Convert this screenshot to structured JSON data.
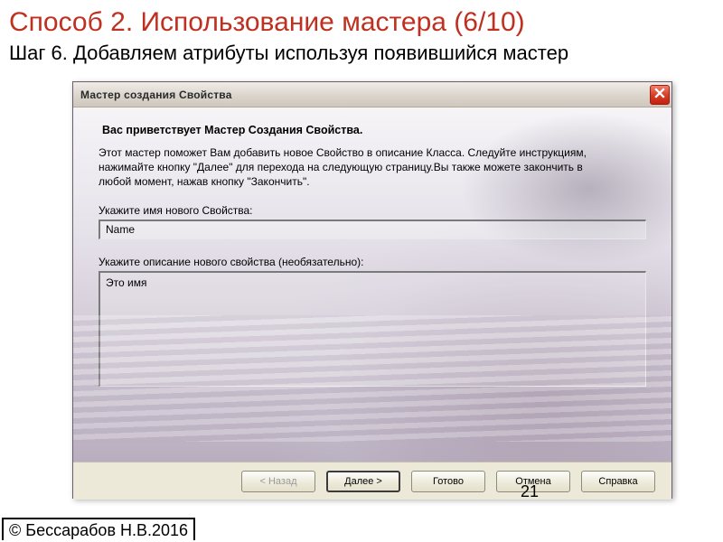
{
  "slide": {
    "title": "Способ 2. Использование мастера (6/10)",
    "step": "Шаг 6. Добавляем атрибуты используя появившийся мастер",
    "page_number": "21",
    "copyright": "© Бессарабов Н.В.2016"
  },
  "dialog": {
    "title": "Мастер создания Свойства",
    "welcome": "Вас приветствует Мастер Создания Свойства.",
    "intro": "Этот мастер поможет Вам добавить новое Свойство в описание Класса. Следуйте инструкциям, нажимайте кнопку \"Далее\" для перехода на следующую страницу.Вы также можете закончить в любой момент, нажав кнопку \"Закончить\".",
    "name_label": "Укажите имя нового Свойства:",
    "name_value": "Name",
    "desc_label": "Укажите описание нового свойства (необязательно):",
    "desc_value": "Это имя",
    "buttons": {
      "back": "< Назад",
      "next": "Далее >",
      "finish": "Готово",
      "cancel": "Отмена",
      "help": "Справка"
    }
  }
}
